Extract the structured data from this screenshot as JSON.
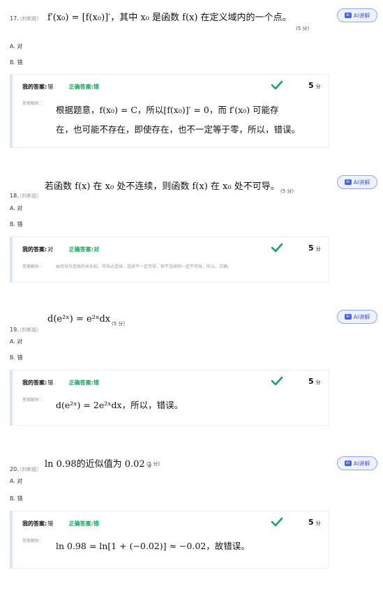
{
  "ai_label": "AI讲解",
  "ai_icon_text": "AI",
  "answer_label": "我的答案:",
  "correct_label": "正确答案:",
  "analysis_label": "答案解析：",
  "points_unit": "分",
  "colors": {
    "correct": "#1aa05a",
    "ai": "#4a5fd8"
  },
  "questions": [
    {
      "num": "17.",
      "type": "(判断题)",
      "stem": "f′(x₀) = [f(x₀)]′，其中 x₀ 是函数 f(x) 在定义域内的一个点。",
      "score": "(5 分)",
      "options": [
        "A. 对",
        "B. 错"
      ],
      "my_answer": "错",
      "correct_answer": "错",
      "points": "5",
      "analysis_lines": [
        "根据题意，f(x₀) = C，所以[f(x₀)]′ = 0，而 f′(x₀) 可能存",
        "在，也可能不存在，即使存在，也不一定等于零，所以，错误。"
      ]
    },
    {
      "num": "18.",
      "type": "(判断题)",
      "stem": "若函数 f(x) 在 x₀ 处不连续，则函数 f(x) 在 x₀ 处不可导。",
      "score": "(5 分)",
      "options": [
        "A. 对",
        "B. 错"
      ],
      "my_answer": "对",
      "correct_answer": "对",
      "points": "5",
      "analysis_small": "由可导与连续的关系知，可导必连续，连续不一定可导，但不连续则一定不可导，所以，正确。"
    },
    {
      "num": "19.",
      "type": "(判断题)",
      "stem": "d(e²ˣ) = e²ˣdx",
      "score": "(5 分)",
      "options": [
        "A. 对",
        "B. 错"
      ],
      "my_answer": "错",
      "correct_answer": "错",
      "points": "5",
      "analysis_lines": [
        "d(e²ˣ) = 2e²ˣdx，所以，错误。"
      ]
    },
    {
      "num": "20.",
      "type": "(判断题)",
      "stem": "ln 0.98的近似值为 0.02 。",
      "score": "(5 分)",
      "options": [
        "A. 对",
        "B. 错"
      ],
      "my_answer": "错",
      "correct_answer": "错",
      "points": "5",
      "analysis_lines": [
        "ln 0.98 = ln[1 + (−0.02)] ≈ −0.02，故错误。"
      ]
    }
  ]
}
